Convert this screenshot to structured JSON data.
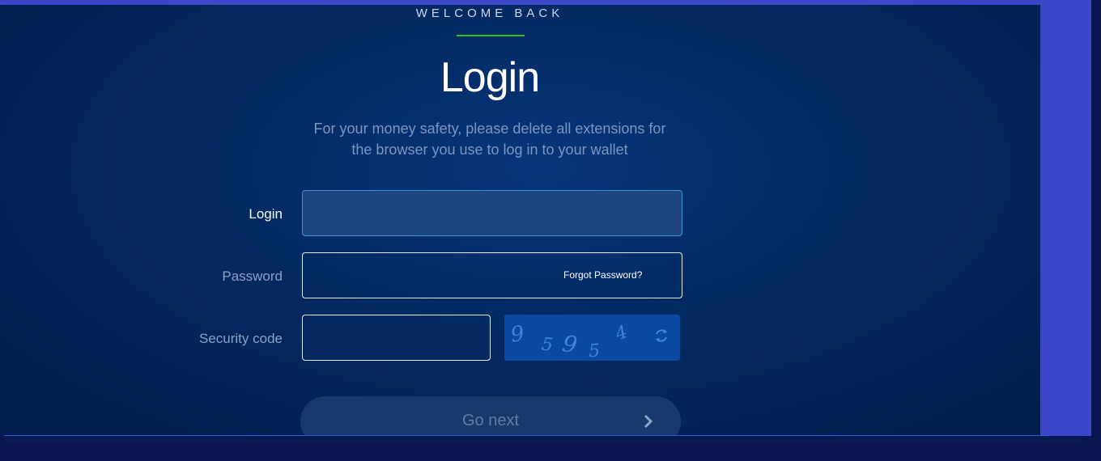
{
  "header": {
    "welcome": "WELCOME BACK",
    "title": "Login",
    "subtitle_line1": "For your money safety, please delete all extensions for",
    "subtitle_line2": "the browser you use to log in to your wallet"
  },
  "form": {
    "login_label": "Login",
    "login_value": "",
    "password_label": "Password",
    "password_value": "",
    "forgot_link": "Forgot Password?",
    "security_label": "Security code",
    "security_value": "",
    "captcha_digits": [
      "9",
      "5",
      "9",
      "5",
      "4"
    ],
    "refresh_icon": "refresh-icon",
    "submit_label": "Go next",
    "submit_icon": "chevron-right-icon"
  },
  "colors": {
    "accent_green": "#2ec21e",
    "frame_blue": "#3d46c9",
    "input_active_border": "#3e91d8"
  }
}
